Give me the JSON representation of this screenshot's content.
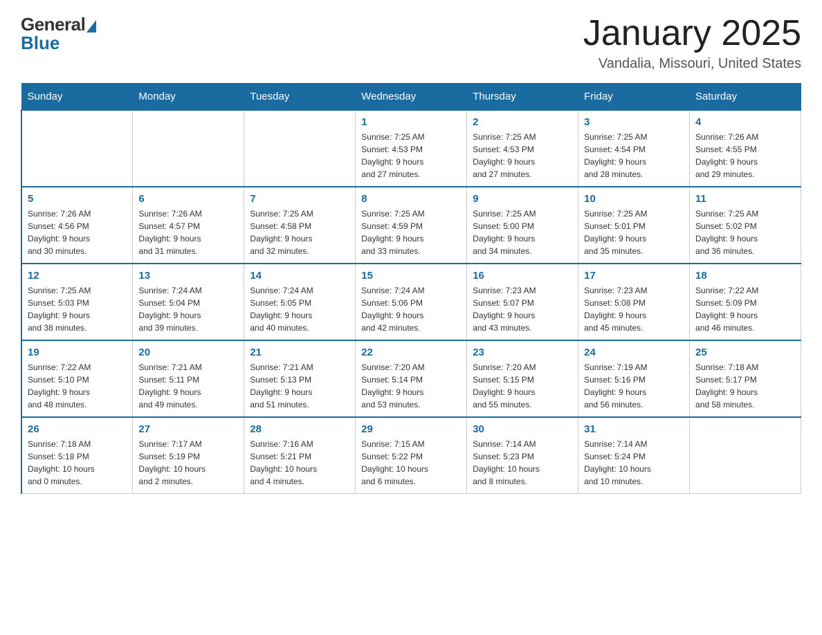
{
  "header": {
    "logo_general": "General",
    "logo_blue": "Blue",
    "month_title": "January 2025",
    "location": "Vandalia, Missouri, United States"
  },
  "days_of_week": [
    "Sunday",
    "Monday",
    "Tuesday",
    "Wednesday",
    "Thursday",
    "Friday",
    "Saturday"
  ],
  "weeks": [
    [
      {
        "day": "",
        "info": ""
      },
      {
        "day": "",
        "info": ""
      },
      {
        "day": "",
        "info": ""
      },
      {
        "day": "1",
        "info": "Sunrise: 7:25 AM\nSunset: 4:53 PM\nDaylight: 9 hours\nand 27 minutes."
      },
      {
        "day": "2",
        "info": "Sunrise: 7:25 AM\nSunset: 4:53 PM\nDaylight: 9 hours\nand 27 minutes."
      },
      {
        "day": "3",
        "info": "Sunrise: 7:25 AM\nSunset: 4:54 PM\nDaylight: 9 hours\nand 28 minutes."
      },
      {
        "day": "4",
        "info": "Sunrise: 7:26 AM\nSunset: 4:55 PM\nDaylight: 9 hours\nand 29 minutes."
      }
    ],
    [
      {
        "day": "5",
        "info": "Sunrise: 7:26 AM\nSunset: 4:56 PM\nDaylight: 9 hours\nand 30 minutes."
      },
      {
        "day": "6",
        "info": "Sunrise: 7:26 AM\nSunset: 4:57 PM\nDaylight: 9 hours\nand 31 minutes."
      },
      {
        "day": "7",
        "info": "Sunrise: 7:25 AM\nSunset: 4:58 PM\nDaylight: 9 hours\nand 32 minutes."
      },
      {
        "day": "8",
        "info": "Sunrise: 7:25 AM\nSunset: 4:59 PM\nDaylight: 9 hours\nand 33 minutes."
      },
      {
        "day": "9",
        "info": "Sunrise: 7:25 AM\nSunset: 5:00 PM\nDaylight: 9 hours\nand 34 minutes."
      },
      {
        "day": "10",
        "info": "Sunrise: 7:25 AM\nSunset: 5:01 PM\nDaylight: 9 hours\nand 35 minutes."
      },
      {
        "day": "11",
        "info": "Sunrise: 7:25 AM\nSunset: 5:02 PM\nDaylight: 9 hours\nand 36 minutes."
      }
    ],
    [
      {
        "day": "12",
        "info": "Sunrise: 7:25 AM\nSunset: 5:03 PM\nDaylight: 9 hours\nand 38 minutes."
      },
      {
        "day": "13",
        "info": "Sunrise: 7:24 AM\nSunset: 5:04 PM\nDaylight: 9 hours\nand 39 minutes."
      },
      {
        "day": "14",
        "info": "Sunrise: 7:24 AM\nSunset: 5:05 PM\nDaylight: 9 hours\nand 40 minutes."
      },
      {
        "day": "15",
        "info": "Sunrise: 7:24 AM\nSunset: 5:06 PM\nDaylight: 9 hours\nand 42 minutes."
      },
      {
        "day": "16",
        "info": "Sunrise: 7:23 AM\nSunset: 5:07 PM\nDaylight: 9 hours\nand 43 minutes."
      },
      {
        "day": "17",
        "info": "Sunrise: 7:23 AM\nSunset: 5:08 PM\nDaylight: 9 hours\nand 45 minutes."
      },
      {
        "day": "18",
        "info": "Sunrise: 7:22 AM\nSunset: 5:09 PM\nDaylight: 9 hours\nand 46 minutes."
      }
    ],
    [
      {
        "day": "19",
        "info": "Sunrise: 7:22 AM\nSunset: 5:10 PM\nDaylight: 9 hours\nand 48 minutes."
      },
      {
        "day": "20",
        "info": "Sunrise: 7:21 AM\nSunset: 5:11 PM\nDaylight: 9 hours\nand 49 minutes."
      },
      {
        "day": "21",
        "info": "Sunrise: 7:21 AM\nSunset: 5:13 PM\nDaylight: 9 hours\nand 51 minutes."
      },
      {
        "day": "22",
        "info": "Sunrise: 7:20 AM\nSunset: 5:14 PM\nDaylight: 9 hours\nand 53 minutes."
      },
      {
        "day": "23",
        "info": "Sunrise: 7:20 AM\nSunset: 5:15 PM\nDaylight: 9 hours\nand 55 minutes."
      },
      {
        "day": "24",
        "info": "Sunrise: 7:19 AM\nSunset: 5:16 PM\nDaylight: 9 hours\nand 56 minutes."
      },
      {
        "day": "25",
        "info": "Sunrise: 7:18 AM\nSunset: 5:17 PM\nDaylight: 9 hours\nand 58 minutes."
      }
    ],
    [
      {
        "day": "26",
        "info": "Sunrise: 7:18 AM\nSunset: 5:18 PM\nDaylight: 10 hours\nand 0 minutes."
      },
      {
        "day": "27",
        "info": "Sunrise: 7:17 AM\nSunset: 5:19 PM\nDaylight: 10 hours\nand 2 minutes."
      },
      {
        "day": "28",
        "info": "Sunrise: 7:16 AM\nSunset: 5:21 PM\nDaylight: 10 hours\nand 4 minutes."
      },
      {
        "day": "29",
        "info": "Sunrise: 7:15 AM\nSunset: 5:22 PM\nDaylight: 10 hours\nand 6 minutes."
      },
      {
        "day": "30",
        "info": "Sunrise: 7:14 AM\nSunset: 5:23 PM\nDaylight: 10 hours\nand 8 minutes."
      },
      {
        "day": "31",
        "info": "Sunrise: 7:14 AM\nSunset: 5:24 PM\nDaylight: 10 hours\nand 10 minutes."
      },
      {
        "day": "",
        "info": ""
      }
    ]
  ]
}
